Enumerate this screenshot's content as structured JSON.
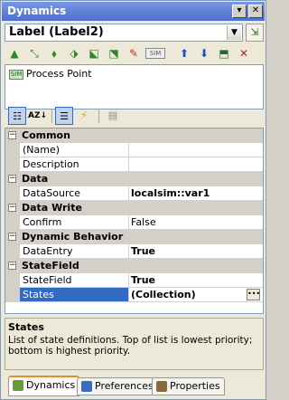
{
  "window": {
    "title": "Dynamics"
  },
  "selector": {
    "value": "Label (Label2)"
  },
  "toolbar": {
    "tools": [
      {
        "name": "tool-up-icon",
        "glyph": "▲"
      },
      {
        "name": "tool-link-icon",
        "glyph": "⤡"
      },
      {
        "name": "tool-node-icon",
        "glyph": "⬧"
      },
      {
        "name": "tool-insert-icon",
        "glyph": "⬗"
      },
      {
        "name": "tool-copy-icon",
        "glyph": "⬕"
      },
      {
        "name": "tool-paste-icon",
        "glyph": "⬔"
      },
      {
        "name": "tool-brush-icon",
        "glyph": "✎"
      },
      {
        "name": "tool-sim-icon",
        "glyph": "SIM"
      },
      {
        "name": "tool-move-up-icon",
        "glyph": "⬆"
      },
      {
        "name": "tool-move-down-icon",
        "glyph": "⬇"
      },
      {
        "name": "tool-edit-icon",
        "glyph": "⬒"
      },
      {
        "name": "tool-delete-icon",
        "glyph": "✕"
      }
    ]
  },
  "pointlist": {
    "items": [
      {
        "label": "Process Point",
        "icon": "SIM"
      }
    ]
  },
  "propgrid": {
    "categories": [
      {
        "label": "Common",
        "rows": [
          {
            "name": "(Name)",
            "value": ""
          },
          {
            "name": "Description",
            "value": ""
          }
        ]
      },
      {
        "label": "Data",
        "rows": [
          {
            "name": "DataSource",
            "value": "localsim::var1"
          }
        ]
      },
      {
        "label": "Data Write",
        "rows": [
          {
            "name": "Confirm",
            "value": "False"
          }
        ]
      },
      {
        "label": "Dynamic Behavior",
        "rows": [
          {
            "name": "DataEntry",
            "value": "True"
          }
        ]
      },
      {
        "label": "StateField",
        "rows": [
          {
            "name": "StateField",
            "value": "True"
          },
          {
            "name": "States",
            "value": "(Collection)"
          }
        ]
      }
    ]
  },
  "description": {
    "title": "States",
    "text": "List of state definitions.  Top of list is lowest priority; bottom is highest priority."
  },
  "tabs": {
    "dynamics": "Dynamics",
    "preferences": "Preferences",
    "properties": "Properties"
  },
  "colors": {
    "titlebar": "#4c6fd0",
    "selection": "#316ac5",
    "tab_highlight": "#e68b2c"
  }
}
